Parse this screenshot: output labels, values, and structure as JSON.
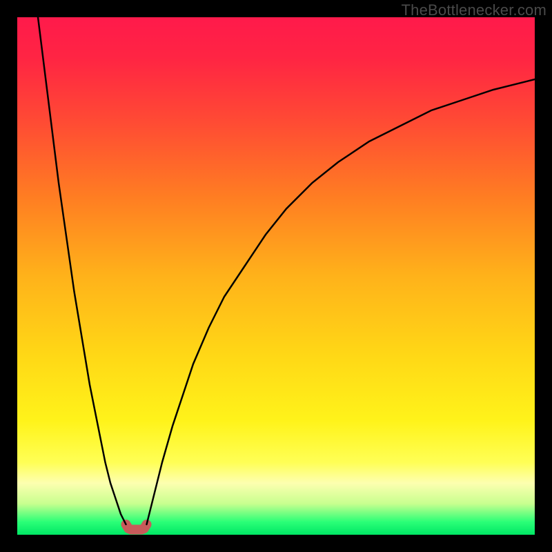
{
  "watermark": {
    "text": "TheBottlenecker.com"
  },
  "chart_data": {
    "type": "line",
    "title": "",
    "xlabel": "",
    "ylabel": "",
    "xlim": [
      0,
      100
    ],
    "ylim": [
      0,
      100
    ],
    "grid": false,
    "legend": false,
    "background_gradient": {
      "stops": [
        {
          "offset": 0.0,
          "color": "#ff1a4b"
        },
        {
          "offset": 0.08,
          "color": "#ff2543"
        },
        {
          "offset": 0.2,
          "color": "#ff4a34"
        },
        {
          "offset": 0.35,
          "color": "#ff7e22"
        },
        {
          "offset": 0.5,
          "color": "#ffb21a"
        },
        {
          "offset": 0.65,
          "color": "#ffd716"
        },
        {
          "offset": 0.78,
          "color": "#fff31a"
        },
        {
          "offset": 0.86,
          "color": "#ffff55"
        },
        {
          "offset": 0.9,
          "color": "#fdffb0"
        },
        {
          "offset": 0.94,
          "color": "#c8ff8f"
        },
        {
          "offset": 0.975,
          "color": "#2bff77"
        },
        {
          "offset": 1.0,
          "color": "#00e765"
        }
      ]
    },
    "series": [
      {
        "name": "left-curve",
        "x": [
          4,
          5,
          6,
          7,
          8,
          9,
          10,
          11,
          12,
          13,
          14,
          15,
          16,
          17,
          18,
          19,
          20,
          21
        ],
        "y": [
          100,
          92,
          84,
          76,
          68,
          61,
          54,
          47,
          41,
          35,
          29,
          24,
          19,
          14,
          10,
          7,
          4,
          2
        ]
      },
      {
        "name": "minimum-marker",
        "x": [
          21,
          21.5,
          22,
          22.5,
          23,
          23.5,
          24,
          24.5,
          25
        ],
        "y": [
          2,
          1.2,
          1,
          1,
          1,
          1,
          1,
          1.2,
          2
        ]
      },
      {
        "name": "right-curve",
        "x": [
          25,
          26,
          27,
          28,
          30,
          32,
          34,
          37,
          40,
          44,
          48,
          52,
          57,
          62,
          68,
          74,
          80,
          86,
          92,
          100
        ],
        "y": [
          2,
          6,
          10,
          14,
          21,
          27,
          33,
          40,
          46,
          52,
          58,
          63,
          68,
          72,
          76,
          79,
          82,
          84,
          86,
          88
        ]
      }
    ],
    "minimum_marker": {
      "x_center": 23,
      "color": "#c85a5a",
      "stroke_width": 14
    },
    "curve_style": {
      "color": "#000000",
      "stroke_width": 2.5
    }
  }
}
